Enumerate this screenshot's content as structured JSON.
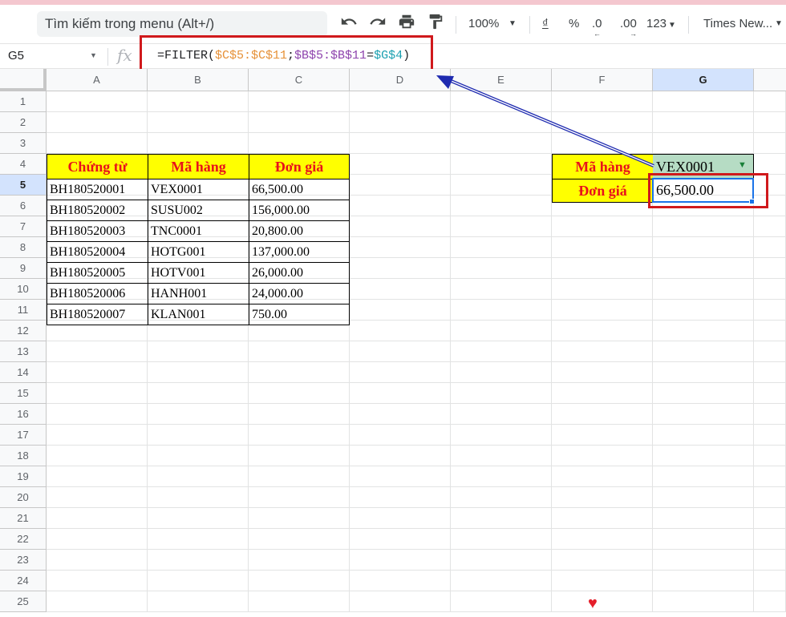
{
  "toolbar": {
    "search_placeholder": "Tìm kiếm trong menu (Alt+/)",
    "zoom": "100%",
    "currency_symbol": "₫",
    "percent_symbol": "%",
    "decrease_decimal": ".0",
    "increase_decimal": ".00",
    "more_formats": "123",
    "font_name": "Times New..."
  },
  "formula_bar": {
    "cell_ref": "G5",
    "fx": "fx",
    "formula_parts": [
      "=FILTER(",
      "$C$5:$C$11",
      ";",
      "$B$5:$B$11",
      "=",
      "$G$4",
      ")"
    ]
  },
  "columns": [
    "A",
    "B",
    "C",
    "D",
    "E",
    "F",
    "G"
  ],
  "rows": [
    "1",
    "2",
    "3",
    "4",
    "5",
    "6",
    "7",
    "8",
    "9",
    "10",
    "11",
    "12",
    "13",
    "14",
    "15",
    "16",
    "17",
    "18",
    "19",
    "20",
    "21",
    "22",
    "23",
    "24",
    "25"
  ],
  "table": {
    "headers": [
      "Chứng từ",
      "Mã hàng",
      "Đơn giá"
    ],
    "rows": [
      [
        "BH180520001",
        "VEX0001",
        "66,500.00"
      ],
      [
        "BH180520002",
        "SUSU002",
        "156,000.00"
      ],
      [
        "BH180520003",
        "TNC0001",
        "20,800.00"
      ],
      [
        "BH180520004",
        "HOTG001",
        "137,000.00"
      ],
      [
        "BH180520005",
        "HOTV001",
        "26,000.00"
      ],
      [
        "BH180520006",
        "HANH001",
        "24,000.00"
      ],
      [
        "BH180520007",
        "KLAN001",
        "750.00"
      ]
    ]
  },
  "lookup": {
    "label_code": "Mã hàng",
    "value_code": "VEX0001",
    "label_price": "Đơn giá",
    "value_price": "66,500.00"
  },
  "colors": {
    "header_fill": "#ffff00",
    "header_text": "#e8111b",
    "dropdown_fill": "#b6dcc4",
    "highlight_red": "#d0191c",
    "arrow": "#1f2bb0"
  }
}
